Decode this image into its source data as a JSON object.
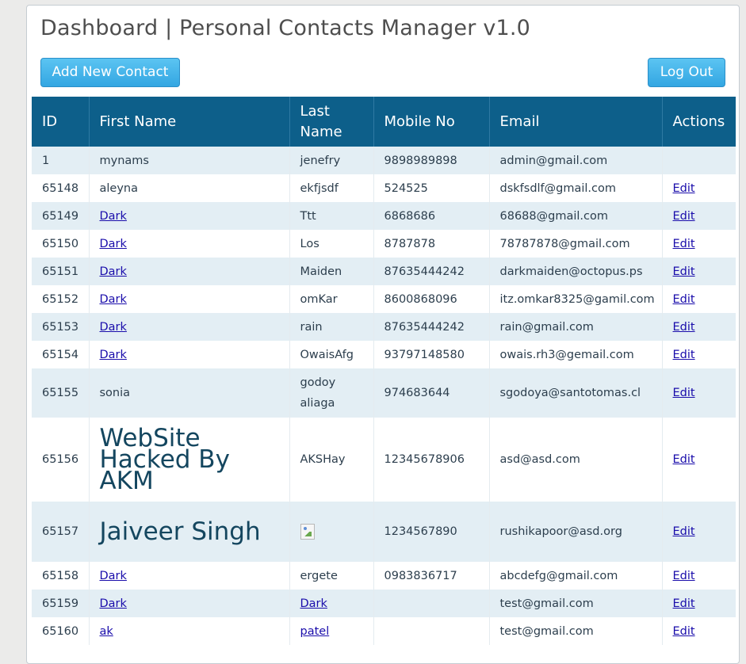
{
  "header": {
    "title": "Dashboard | Personal Contacts Manager v1.0",
    "add_button_label": "Add New Contact",
    "logout_button_label": "Log Out"
  },
  "table": {
    "columns": [
      "ID",
      "First Name",
      "Last\nName",
      "Mobile No",
      "Email",
      "Actions"
    ],
    "rows": [
      {
        "id": "1",
        "first_name": "mynams",
        "last_name": "jenefry",
        "mobile": "9898989898",
        "email": "admin@gmail.com",
        "action": ""
      },
      {
        "id": "65148",
        "first_name": "aleyna",
        "last_name": "ekfjsdf",
        "mobile": "524525",
        "email": "dskfsdlf@gmail.com",
        "action": "Edit"
      },
      {
        "id": "65149",
        "first_name": "Dark",
        "last_name": "Ttt",
        "mobile": "6868686",
        "email": "68688@gmail.com",
        "action": "Edit"
      },
      {
        "id": "65150",
        "first_name": "Dark",
        "last_name": "Los",
        "mobile": "8787878",
        "email": "78787878@gmail.com",
        "action": "Edit"
      },
      {
        "id": "65151",
        "first_name": "Dark",
        "last_name": "Maiden",
        "mobile": "87635444242",
        "email": "darkmaiden@octopus.ps",
        "action": "Edit"
      },
      {
        "id": "65152",
        "first_name": "Dark",
        "last_name": "omKar",
        "mobile": "8600868096",
        "email": "itz.omkar8325@gamil.com",
        "action": "Edit"
      },
      {
        "id": "65153",
        "first_name": "Dark",
        "last_name": "rain",
        "mobile": "87635444242",
        "email": "rain@gmail.com",
        "action": "Edit"
      },
      {
        "id": "65154",
        "first_name": "Dark",
        "last_name": "OwaisAfg",
        "mobile": "93797148580",
        "email": "owais.rh3@gemail.com",
        "action": "Edit"
      },
      {
        "id": "65155",
        "first_name": "sonia",
        "last_name": "godoy aliaga",
        "mobile": "974683644",
        "email": "sgodoya@santotomas.cl",
        "action": "Edit"
      },
      {
        "id": "65156",
        "first_name": "WebSite Hacked By AKM",
        "last_name": "AKSHay",
        "mobile": "12345678906",
        "email": "asd@asd.com",
        "action": "Edit"
      },
      {
        "id": "65157",
        "first_name": "Jaiveer Singh",
        "last_name": "",
        "mobile": "1234567890",
        "email": "rushikapoor@asd.org",
        "action": "Edit"
      },
      {
        "id": "65158",
        "first_name": "Dark",
        "last_name": "ergete",
        "mobile": "0983836717",
        "email": "abcdefg@gmail.com",
        "action": "Edit"
      },
      {
        "id": "65159",
        "first_name": "Dark",
        "last_name": "Dark",
        "mobile": "",
        "email": "test@gmail.com",
        "action": "Edit"
      },
      {
        "id": "65160",
        "first_name": "ak",
        "last_name": "patel",
        "mobile": "",
        "email": "test@gmail.com",
        "action": "Edit"
      }
    ]
  }
}
